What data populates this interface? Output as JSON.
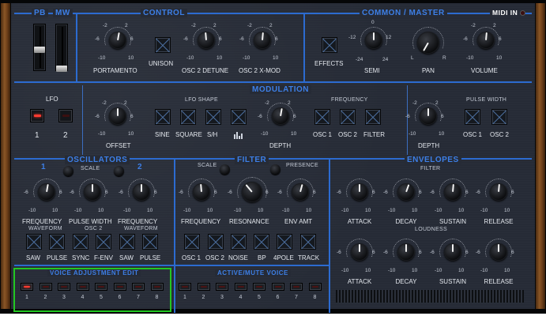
{
  "header": {
    "pb": "PB",
    "mw": "MW",
    "control": "CONTROL",
    "common_master": "COMMON / MASTER",
    "midi_in": "MIDI IN"
  },
  "control": {
    "portamento": "PORTAMENTO",
    "unison": "UNISON",
    "osc2_detune": "OSC 2 DETUNE",
    "osc2_xmod": "OSC 2 X-MOD"
  },
  "master": {
    "effects": "EFFECTS",
    "semi": "SEMI",
    "pan": "PAN",
    "volume": "VOLUME"
  },
  "ticks": {
    "lo": "-10",
    "hi": "10",
    "n8": "-8",
    "p8": "8",
    "n6": "-6",
    "p6": "6",
    "n4": "-4",
    "p4": "4",
    "n2": "-2",
    "p2": "2",
    "zero": "0",
    "n12": "-12",
    "p12": "12",
    "n24": "-24",
    "p24": "24",
    "l": "L",
    "r": "R"
  },
  "modulation": {
    "title": "MODULATION",
    "lfo": "LFO",
    "lfo1": "1",
    "lfo2": "2",
    "offset": "OFFSET",
    "lfo_shape": "LFO SHAPE",
    "sine": "SINE",
    "square": "SQUARE",
    "sh": "S/H",
    "depth": "DEPTH",
    "frequency": "FREQUENCY",
    "osc1": "OSC 1",
    "osc2": "OSC 2",
    "filter": "FILTER",
    "pulse_width": "PULSE WIDTH",
    "depth2": "DEPTH",
    "pw_osc1": "OSC 1",
    "pw_osc2": "OSC 2"
  },
  "oscillators": {
    "title": "OSCILLATORS",
    "one": "1",
    "two": "2",
    "scale": "SCALE",
    "frequency": "FREQUENCY",
    "pulse_width": "PULSE WIDTH",
    "frequency2": "FREQUENCY",
    "waveform": "WAVEFORM",
    "osc2": "OSC 2",
    "waveform2": "WAVEFORM",
    "saw": "SAW",
    "pulse": "PULSE",
    "sync": "SYNC",
    "fenv": "F-ENV",
    "saw2": "SAW",
    "pulse2": "PULSE"
  },
  "filter": {
    "title": "FILTER",
    "scale": "SCALE",
    "presence": "PRESENCE",
    "frequency": "FREQUENCY",
    "resonance": "RESONANCE",
    "env_amt": "ENV AMT",
    "osc1": "OSC 1",
    "osc2": "OSC 2",
    "noise": "NOISE",
    "bp": "BP",
    "fourpole": "4POLE",
    "track": "TRACK"
  },
  "envelopes": {
    "title": "ENVELOPES",
    "filter": "FILTER",
    "loudness": "LOUDNESS",
    "attack": "ATTACK",
    "decay": "DECAY",
    "sustain": "SUSTAIN",
    "release": "RELEASE"
  },
  "voice": {
    "adjust_title": "VOICE ADJUSTMENT EDIT",
    "mute_title": "ACTIVE/MUTE VOICE",
    "numbers": [
      "1",
      "2",
      "3",
      "4",
      "5",
      "6",
      "7",
      "8"
    ]
  },
  "colors": {
    "accent": "#3d7fe6",
    "led_on": "#ff3b30",
    "highlight": "#22c722"
  }
}
